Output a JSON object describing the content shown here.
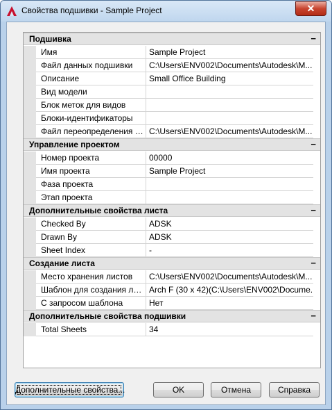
{
  "window": {
    "title": "Свойства подшивки - Sample Project",
    "close_glyph": "✕",
    "close_color": "#c8442f"
  },
  "sections": [
    {
      "title": "Подшивка",
      "toggle": "−",
      "rows": [
        {
          "name": "Имя",
          "value": "Sample Project"
        },
        {
          "name": "Файл данных подшивки",
          "value": "C:\\Users\\ENV002\\Documents\\Autodesk\\M..."
        },
        {
          "name": "Описание",
          "value": "Small Office Building"
        },
        {
          "name": "Вид модели",
          "value": ""
        },
        {
          "name": "Блок меток для видов",
          "value": ""
        },
        {
          "name": "Блоки-идентификаторы",
          "value": ""
        },
        {
          "name": "Файл переопределения па...",
          "value": "C:\\Users\\ENV002\\Documents\\Autodesk\\M..."
        }
      ]
    },
    {
      "title": "Управление проектом",
      "toggle": "−",
      "rows": [
        {
          "name": "Номер проекта",
          "value": "00000"
        },
        {
          "name": "Имя проекта",
          "value": "Sample Project"
        },
        {
          "name": "Фаза проекта",
          "value": ""
        },
        {
          "name": "Этап проекта",
          "value": ""
        }
      ]
    },
    {
      "title": "Дополнительные свойства листа",
      "toggle": "−",
      "rows": [
        {
          "name": "Checked By",
          "value": "ADSK"
        },
        {
          "name": "Drawn By",
          "value": "ADSK"
        },
        {
          "name": "Sheet Index",
          "value": "-"
        }
      ]
    },
    {
      "title": "Создание листа",
      "toggle": "−",
      "rows": [
        {
          "name": "Место хранения листов",
          "value": "C:\\Users\\ENV002\\Documents\\Autodesk\\M..."
        },
        {
          "name": "Шаблон для создания лист...",
          "value": "Arch F (30 x 42)(C:\\Users\\ENV002\\Docume..."
        },
        {
          "name": "С запросом шаблона",
          "value": "Нет"
        }
      ]
    },
    {
      "title": "Дополнительные свойства подшивки",
      "toggle": "−",
      "rows": [
        {
          "name": "Total Sheets",
          "value": "34"
        }
      ]
    }
  ],
  "buttons": {
    "more_props": "Дополнительные свойства...",
    "ok": "OK",
    "cancel": "Отмена",
    "help": "Справка"
  }
}
